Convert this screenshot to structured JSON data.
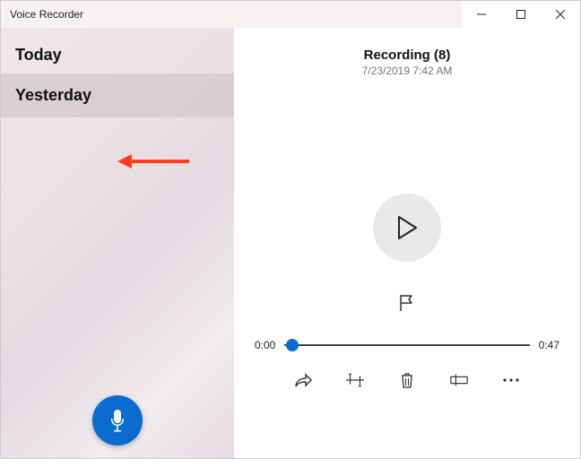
{
  "window": {
    "title": "Voice Recorder"
  },
  "sidebar": {
    "groups": [
      {
        "label": "Today",
        "selected": false
      },
      {
        "label": "Yesterday",
        "selected": true
      }
    ]
  },
  "main": {
    "recording_title": "Recording (8)",
    "recording_datetime": "7/23/2019 7:42 AM",
    "current_time": "0:00",
    "total_time": "0:47"
  },
  "colors": {
    "accent": "#0a6cce"
  }
}
